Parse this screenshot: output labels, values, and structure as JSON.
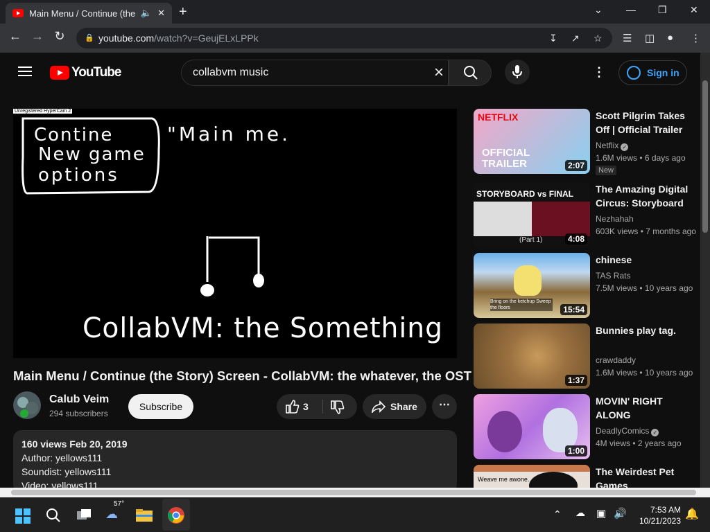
{
  "browser": {
    "tab_title": "Main Menu / Continue (the",
    "url_host": "youtube.com",
    "url_path": "/watch?v=GeujELxLPPk",
    "new_tab_symbol": "+",
    "icons": [
      "back-icon",
      "forward-icon",
      "reload-icon",
      "lock-icon",
      "install-icon",
      "share-icon",
      "star-icon",
      "media-icon",
      "sidepanel-icon",
      "profile-icon",
      "menu-icon"
    ]
  },
  "yt": {
    "logo_text": "YouTube",
    "search_value": "collabvm music",
    "signin_label": "Sign in"
  },
  "video": {
    "watermark": "Unregistered HyperCam 2",
    "menu_lines": [
      "Contine",
      "New game",
      "options"
    ],
    "heading_text": "\"Main me.",
    "bottom_text": "CollabVM: the Something",
    "title": "Main Menu / Continue (the Story) Screen - CollabVM: the whatever, the OST",
    "channel_name": "Calub Veim",
    "subscribers": "294 subscribers",
    "subscribe_label": "Subscribe",
    "like_count": "3",
    "share_label": "Share",
    "description": {
      "meta_line": "160 views  Feb 20, 2019",
      "lines": [
        "Author: yellows111",
        "Soundist: yellows111",
        "Video: yellows111"
      ]
    }
  },
  "related": [
    {
      "title": "Scott Pilgrim Takes Off | Official Trailer",
      "channel": "Netflix",
      "verified": true,
      "views": "1.6M views",
      "age": "6 days ago",
      "duration": "2:07",
      "badge": "New",
      "thumb_text": "OFFICIAL TRAILER",
      "thumb_brand": "NETFLIX"
    },
    {
      "title": "The Amazing Digital Circus: Storyboard vs Final",
      "channel": "Nezhahah",
      "verified": false,
      "views": "603K views",
      "age": "7 months ago",
      "duration": "4:08",
      "badge": "",
      "thumb_text": "STORYBOARD vs FINAL",
      "thumb_sub": "(Part 1)"
    },
    {
      "title": "chinese",
      "channel": "TAS Rats",
      "verified": false,
      "views": "7.5M views",
      "age": "10 years ago",
      "duration": "15:54",
      "badge": "",
      "thumb_text": "Bring on the ketchup Sweep the floors"
    },
    {
      "title": "Bunnies play tag.",
      "channel": "crawdaddy",
      "verified": false,
      "views": "1.6M views",
      "age": "10 years ago",
      "duration": "1:37",
      "badge": ""
    },
    {
      "title": "MOVIN' RIGHT ALONG",
      "channel": "DeadlyComics",
      "verified": true,
      "views": "4M views",
      "age": "2 years ago",
      "duration": "1:00",
      "badge": ""
    },
    {
      "title": "The Weirdest Pet Games",
      "channel": "",
      "verified": false,
      "views": "",
      "age": "",
      "duration": "",
      "badge": "",
      "thumb_text": "Weave me awone."
    }
  ],
  "taskbar": {
    "temperature": "57°",
    "time": "7:53 AM",
    "date": "10/21/2023"
  }
}
